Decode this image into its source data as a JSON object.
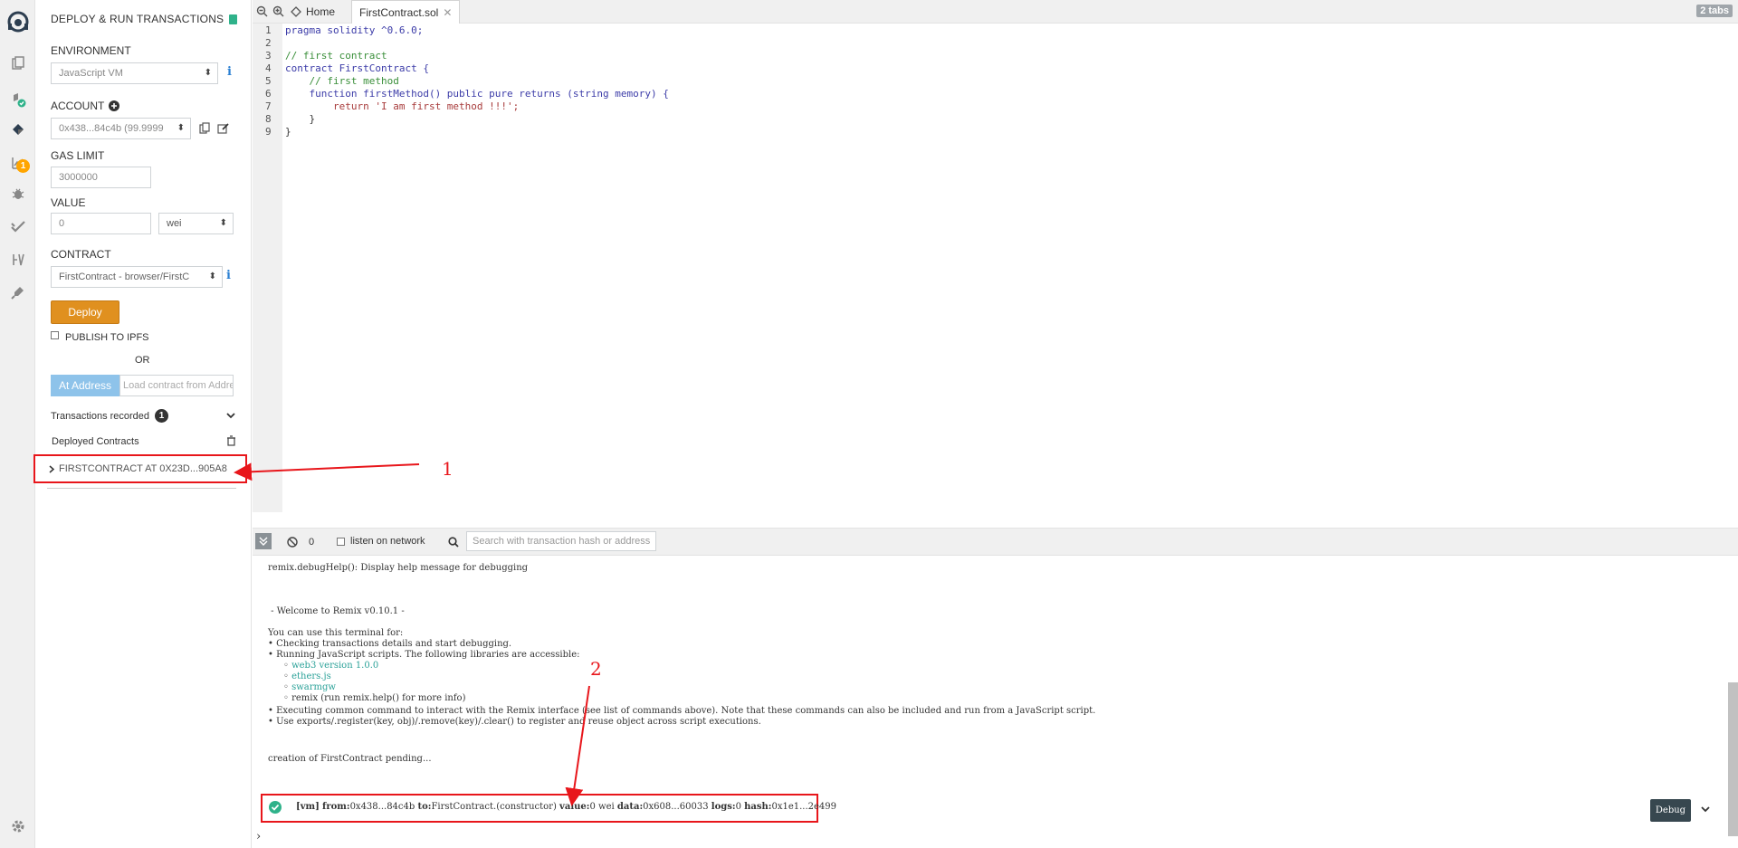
{
  "plugin": {
    "title": "DEPLOY & RUN TRANSACTIONS",
    "environment_label": "ENVIRONMENT",
    "environment_value": "JavaScript VM",
    "account_label": "ACCOUNT",
    "account_value": "0x438...84c4b (99.9999",
    "gas_limit_label": "GAS LIMIT",
    "gas_limit_value": "3000000",
    "value_label": "VALUE",
    "value_amount": "0",
    "value_unit": "wei",
    "contract_label": "CONTRACT",
    "contract_value": "FirstContract - browser/FirstC",
    "deploy_label": "Deploy",
    "publish_label": "PUBLISH TO IPFS",
    "or_label": "OR",
    "at_address_label": "At Address",
    "at_address_placeholder": "Load contract from Address",
    "tx_recorded_label": "Transactions recorded",
    "tx_recorded_count": "1",
    "deployed_label": "Deployed Contracts",
    "deployed_instance": "FIRSTCONTRACT AT 0X23D...905A8"
  },
  "annotations": {
    "one": "1",
    "two": "2"
  },
  "tabs": {
    "home": "Home",
    "file": "FirstContract.sol",
    "count": "2 tabs"
  },
  "editor": {
    "line_numbers": [
      "1",
      "2",
      "3",
      "4",
      "5",
      "6",
      "7",
      "8",
      "9"
    ],
    "l1": "pragma solidity ^0.6.0;",
    "l3": "// first contract",
    "l4": "contract FirstContract {",
    "l5": "    // first method",
    "l6": "    function firstMethod() public pure returns (string memory) {",
    "l7": "        return 'I am first method !!!';",
    "l8": "    }",
    "l9": "}"
  },
  "terminal": {
    "counter": "0",
    "listen_label": "listen on network",
    "search_placeholder": "Search with transaction hash or address",
    "help_line": "remix.debugHelp(): Display help message for debugging",
    "welcome": " - Welcome to Remix v0.10.1 -",
    "use_line": "You can use this terminal for:",
    "b1": "• Checking transactions details and start debugging.",
    "b2": "• Running JavaScript scripts. The following libraries are accessible:",
    "lib1": "web3 version 1.0.0",
    "lib2": "ethers.js",
    "lib3": "swarmgw",
    "lib4": "remix (run remix.help() for more info)",
    "b3": "• Executing common command to interact with the Remix interface (see list of commands above). Note that these commands can also be included and run from a JavaScript script.",
    "b4": "• Use exports/.register(key, obj)/.remove(key)/.clear() to register and reuse object across script executions.",
    "pending": "creation of FirstContract pending...",
    "tx_vm": "[vm]",
    "tx_from_k": "from:",
    "tx_from_v": "0x438...84c4b",
    "tx_to_k": "to:",
    "tx_to_v": "FirstContract.(constructor)",
    "tx_value_k": "value:",
    "tx_value_v": "0 wei",
    "tx_data_k": "data:",
    "tx_data_v": "0x608...60033",
    "tx_logs_k": "logs:",
    "tx_logs_v": "0",
    "tx_hash_k": "hash:",
    "tx_hash_v": "0x1e1...2e499",
    "debug_label": "Debug",
    "prompt": "›"
  },
  "colors": {
    "deploy": "#e0901f",
    "at_address": "#8ec3ea",
    "annotation_red": "#e8161b",
    "success_green": "#2fb28a"
  }
}
